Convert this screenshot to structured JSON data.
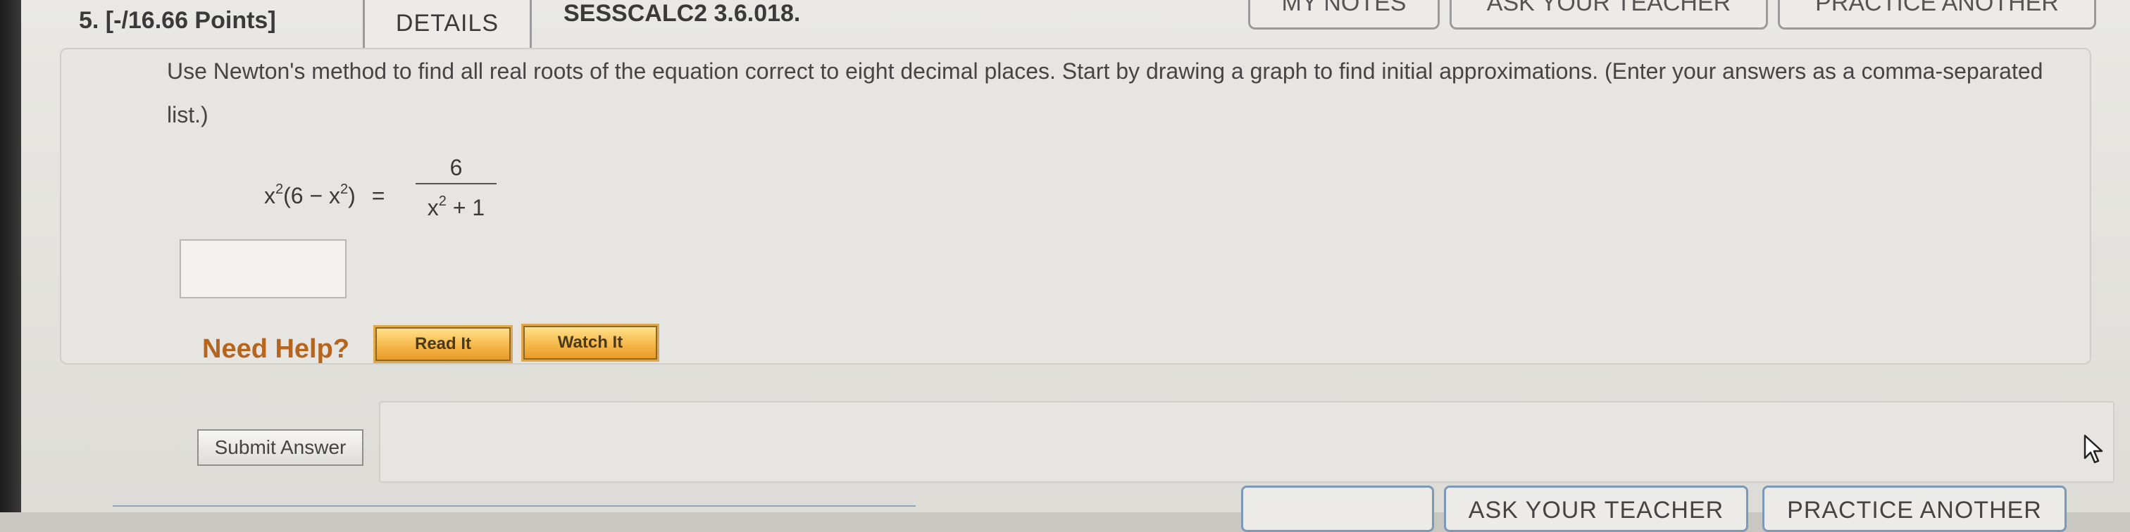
{
  "question": {
    "number_points": "5. [-/16.66 Points]",
    "details_tab": "DETAILS",
    "problem_code": "SESSCALC2 3.6.018.",
    "prompt": "Use Newton's method to find all real roots of the equation correct to eight decimal places. Start by drawing a graph to find initial approximations. (Enter your answers as a comma-separated list.)"
  },
  "top_buttons": {
    "my_notes": "MY NOTES",
    "ask_your_teacher": "ASK YOUR TEACHER",
    "practice_another": "PRACTICE ANOTHER"
  },
  "equation": {
    "lhs_x": "x",
    "lhs_exp": "2",
    "lhs_open": "(6 − x",
    "lhs_inner_exp": "2",
    "lhs_close": ")",
    "equals": "=",
    "numerator": "6",
    "den_x": "x",
    "den_exp": "2",
    "den_rest": " + 1"
  },
  "answer": {
    "value": "",
    "placeholder": ""
  },
  "help": {
    "label": "Need Help?",
    "read_it": "Read It",
    "watch_it": "Watch It"
  },
  "submit": {
    "label": "Submit Answer"
  },
  "bottom_buttons": {
    "ask_your_teacher": "ASK YOUR TEACHER",
    "practice_another": "PRACTICE ANOTHER"
  },
  "colors": {
    "need_help": "#b5651d",
    "help_button": "#f6b84a",
    "bottom_button_border": "#7c99b8"
  }
}
